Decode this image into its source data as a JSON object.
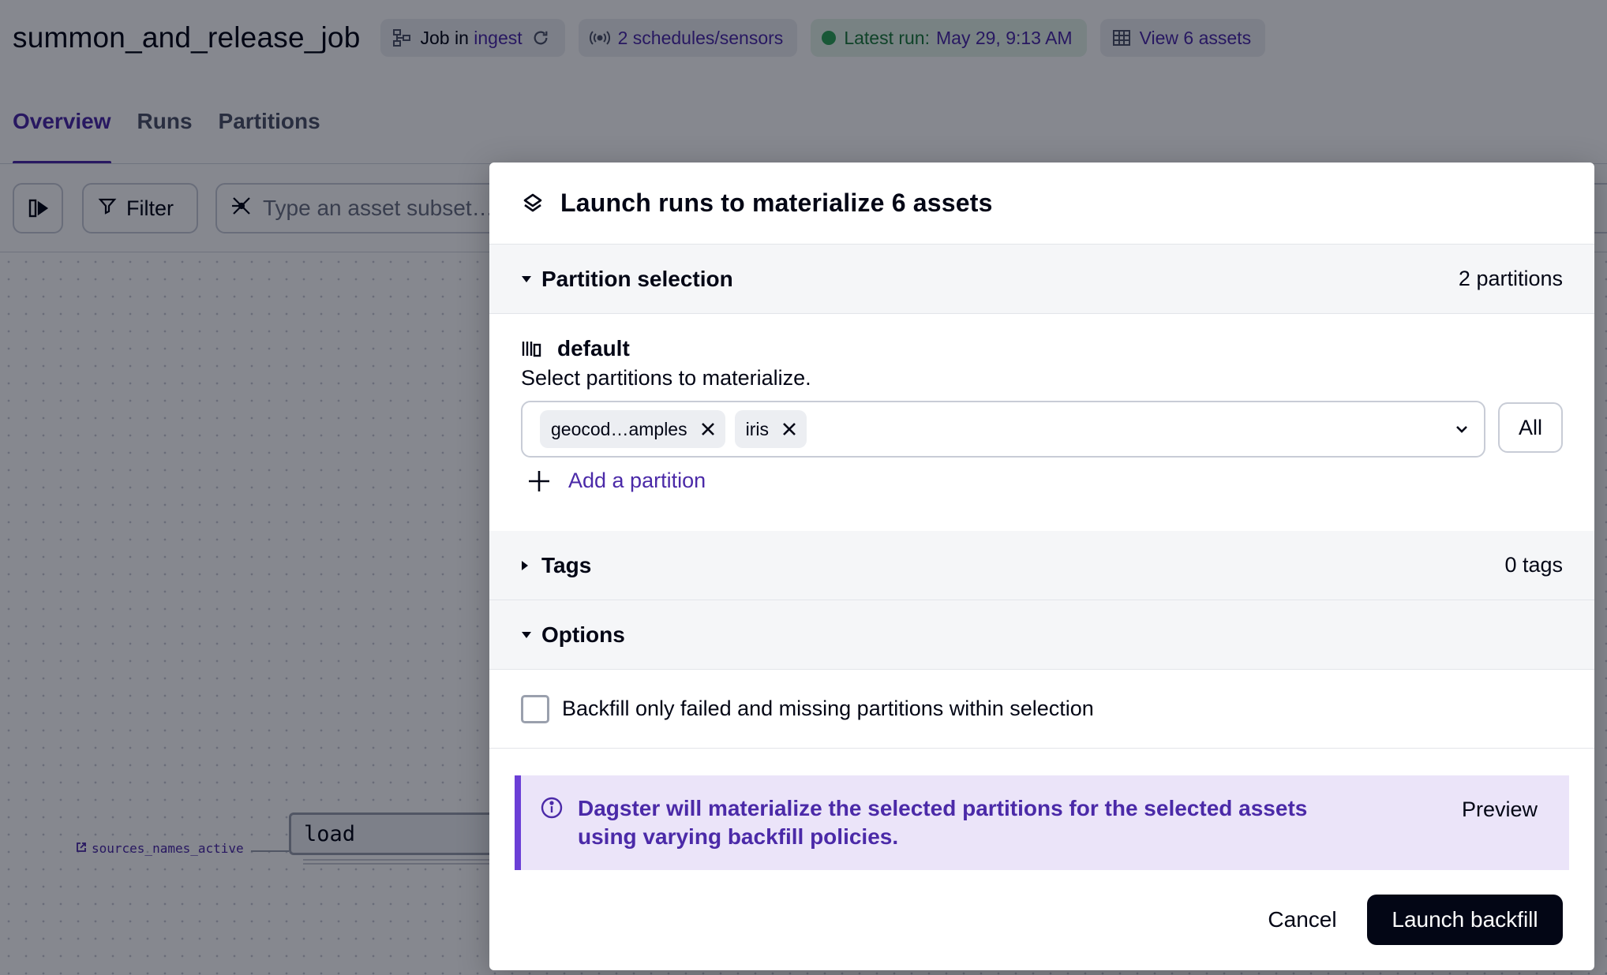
{
  "header": {
    "job_name": "summon_and_release_job",
    "job_prefix": "Job in",
    "job_location": "ingest",
    "schedules": "2 schedules/sensors",
    "latest_run_label": "Latest run:",
    "latest_run_value": "May 29, 9:13 AM",
    "assets_link": "View 6 assets"
  },
  "tabs": [
    {
      "label": "Overview",
      "active": true
    },
    {
      "label": "Runs",
      "active": false
    },
    {
      "label": "Partitions",
      "active": false
    }
  ],
  "toolbar": {
    "filter_label": "Filter",
    "search_placeholder": "Type an asset subset…"
  },
  "graph": {
    "source_label": "sources_names_active",
    "node_label": "load"
  },
  "dialog": {
    "title": "Launch runs to materialize 6 assets",
    "partition_section": {
      "title": "Partition selection",
      "count": "2 partitions",
      "expanded": true,
      "partition_name": "default",
      "description": "Select partitions to materialize.",
      "selected": [
        "geocod…amples",
        "iris"
      ],
      "all_label": "All",
      "add_label": "Add a partition"
    },
    "tags_section": {
      "title": "Tags",
      "count": "0 tags",
      "expanded": false
    },
    "options_section": {
      "title": "Options",
      "expanded": true,
      "checkbox_label": "Backfill only failed and missing partitions within selection",
      "checked": false
    },
    "alert": {
      "text": "Dagster will materialize the selected partitions for the selected assets using varying backfill policies.",
      "preview_label": "Preview"
    },
    "footer": {
      "cancel_label": "Cancel",
      "launch_label": "Launch backfill"
    }
  },
  "colors": {
    "accent": "#4b2aa8",
    "alert_bg": "#ebe4f9",
    "alert_border": "#6b3fd6",
    "success": "#2fa356",
    "primary_button": "#030615"
  }
}
